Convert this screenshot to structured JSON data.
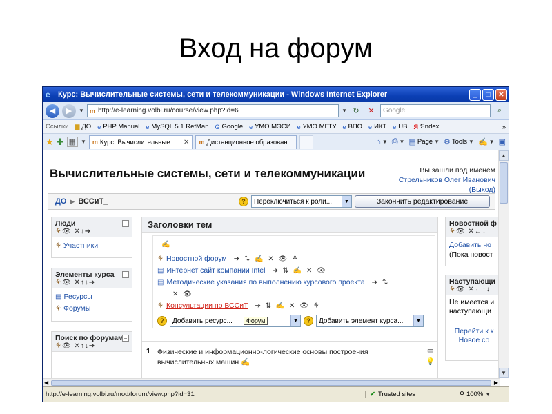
{
  "slide_title": "Вход на форум",
  "window": {
    "title": "Курс: Вычислительные системы, сети и телекоммуникации - Windows Internet Explorer",
    "url": "http://e-learning.volbi.ru/course/view.php?id=6",
    "search_placeholder": "Google",
    "links_label": "Ссылки",
    "links": [
      "ДО",
      "PHP Manual",
      "MySQL 5.1 RefMan",
      "Google",
      "УМО МЭСИ",
      "УМО МГТУ",
      "ВПО",
      "ИКТ",
      "UB",
      "Яndex"
    ],
    "tabs": [
      "Курс: Вычислительные ...",
      "Дистанционное образован..."
    ],
    "commands": {
      "page": "Page",
      "tools": "Tools"
    },
    "status_url": "http://e-learning.volbi.ru/mod/forum/view.php?id=31",
    "trusted": "Trusted sites",
    "zoom": "100%"
  },
  "course": {
    "title": "Вычислительные системы, сети и телекоммуникации",
    "login": {
      "prefix": "Вы зашли под именем",
      "user": "Стрельников Олег Иванович",
      "logout": "(Выход)"
    },
    "breadcrumb": {
      "root": "ДО",
      "current": "ВССиТ_"
    },
    "role_select": "Переключиться к роли...",
    "end_edit_button": "Закончить редактирование"
  },
  "left_blocks": {
    "people": {
      "title": "Люди",
      "items": [
        "Участники"
      ]
    },
    "activities": {
      "title": "Элементы курса",
      "items": [
        "Ресурсы",
        "Форумы"
      ]
    },
    "search": {
      "title": "Поиск по форумам"
    }
  },
  "center": {
    "header": "Заголовки тем",
    "activities": [
      "Новостной форум",
      "Интернет сайт компании Intel",
      "Методические указания по выполнению курсового проекта",
      "Консультации по ВССиТ"
    ],
    "add_resource": "Добавить ресурс...",
    "add_activity": "Добавить элемент курса...",
    "tooltip": "Форум",
    "topic1_num": "1",
    "topic1_text": "Физические и информационно-логические основы построения вычислительных машин"
  },
  "right_blocks": {
    "news": {
      "title": "Новостной ф",
      "add": "Добавить но",
      "note": "(Пока новост"
    },
    "upcoming": {
      "title": "Наступающи",
      "line1": "Не имеется и",
      "line2": "наступающи",
      "link1": "Перейти к к",
      "link2": "Новое со"
    }
  }
}
